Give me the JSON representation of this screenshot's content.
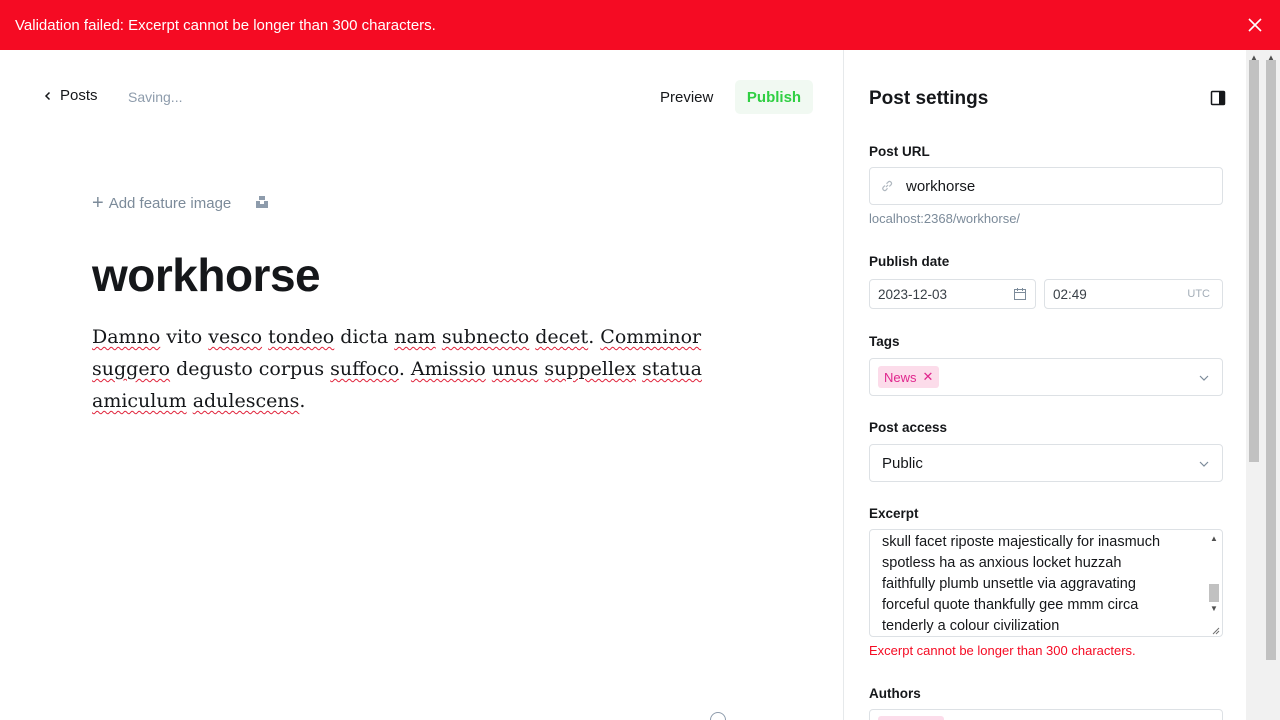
{
  "alert": {
    "message": "Validation failed: Excerpt cannot be longer than 300 characters.",
    "color": "#f50b23"
  },
  "topbar": {
    "back_label": "Posts",
    "status": "Saving...",
    "preview_label": "Preview",
    "publish_label": "Publish"
  },
  "editor": {
    "feature_image_label": "Add feature image",
    "title": "workhorse",
    "body": [
      {
        "t": "Damno",
        "s": true
      },
      {
        "t": " vito ",
        "s": false
      },
      {
        "t": "vesco",
        "s": true
      },
      {
        "t": " ",
        "s": false
      },
      {
        "t": "tondeo",
        "s": true
      },
      {
        "t": " dicta ",
        "s": false
      },
      {
        "t": "nam",
        "s": true
      },
      {
        "t": " ",
        "s": false
      },
      {
        "t": "subnecto",
        "s": true
      },
      {
        "t": " ",
        "s": false
      },
      {
        "t": "decet",
        "s": true
      },
      {
        "t": ". ",
        "s": false
      },
      {
        "t": "Comminor",
        "s": true
      },
      {
        "t": " ",
        "s": false
      },
      {
        "t": "suggero",
        "s": true
      },
      {
        "t": " ",
        "s": false
      },
      {
        "t": "degusto corpus ",
        "s": false
      },
      {
        "t": "suffoco",
        "s": true
      },
      {
        "t": ". ",
        "s": false
      },
      {
        "t": "Amissio",
        "s": true
      },
      {
        "t": " ",
        "s": false
      },
      {
        "t": "unus",
        "s": true
      },
      {
        "t": " ",
        "s": false
      },
      {
        "t": "suppellex",
        "s": true
      },
      {
        "t": " ",
        "s": false
      },
      {
        "t": "statua",
        "s": true
      },
      {
        "t": " ",
        "s": false
      },
      {
        "t": "amiculum",
        "s": true
      },
      {
        "t": " ",
        "s": false
      },
      {
        "t": "adulescens",
        "s": true
      },
      {
        "t": ".",
        "s": false
      }
    ]
  },
  "settings": {
    "title": "Post settings",
    "post_url_label": "Post URL",
    "post_url_value": "workhorse",
    "post_url_hint": "localhost:2368/workhorse/",
    "publish_date_label": "Publish date",
    "publish_date": "2023-12-03",
    "publish_time": "02:49",
    "timezone": "UTC",
    "tags_label": "Tags",
    "tags": [
      "News"
    ],
    "access_label": "Post access",
    "access_value": "Public",
    "excerpt_label": "Excerpt",
    "excerpt_lines": [
      "skull facet riposte majestically for inasmuch",
      "spotless ha as anxious locket huzzah",
      "faithfully plumb unsettle via aggravating",
      "forceful quote thankfully gee mmm circa",
      "tenderly a colour civilization"
    ],
    "excerpt_error": "Excerpt cannot be longer than 300 characters.",
    "authors_label": "Authors"
  }
}
